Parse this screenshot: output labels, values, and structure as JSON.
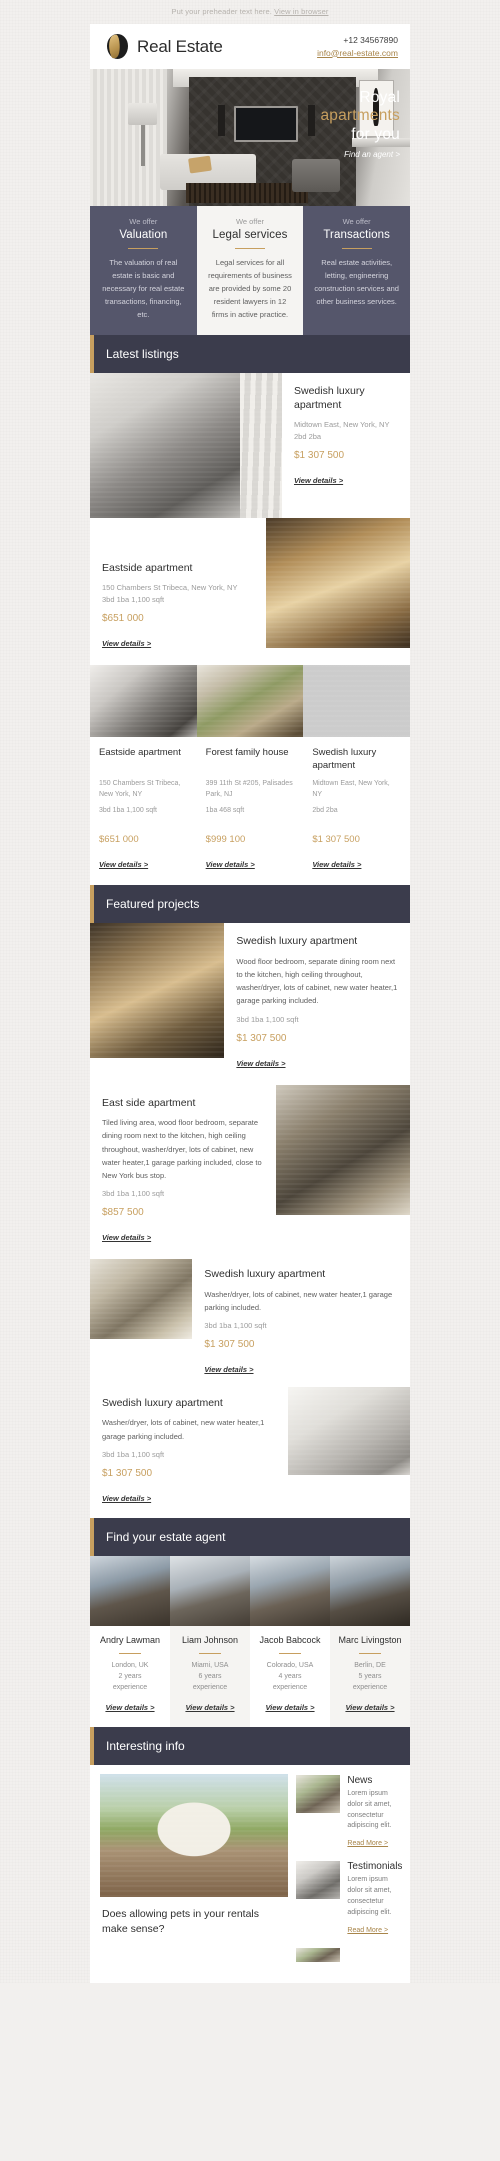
{
  "preheader": {
    "text": "Put your preheader text here.",
    "link": "View in browser"
  },
  "header": {
    "brand": "Real Estate",
    "phone": "+12 34567890",
    "email": "info@real-estate.com"
  },
  "hero": {
    "line1": "Royal",
    "line2": "apartments",
    "line3": "for you",
    "cta": "Find an agent >"
  },
  "offers": [
    {
      "kicker": "We offer",
      "title": "Valuation",
      "body": "The valuation of real estate is basic and necessary for real estate transactions, financing, etc."
    },
    {
      "kicker": "We offer",
      "title": "Legal services",
      "body": "Legal services for all requirements of business are provided by some 20 resident lawyers in 12 firms in active practice."
    },
    {
      "kicker": "We offer",
      "title": "Transactions",
      "body": "Real estate activities, letting, engineering construction services and other business services."
    }
  ],
  "sections": {
    "latest": "Latest listings",
    "featured": "Featured projects",
    "agents": "Find your estate agent",
    "info": "Interesting info"
  },
  "latest": {
    "card1": {
      "title": "Swedish luxury apartment",
      "meta": "Midtown East, New York, NY",
      "specs": "2bd 2ba",
      "price": "$1 307 500",
      "cta": "View details >"
    },
    "card2": {
      "title": "Eastside apartment",
      "meta": "150 Chambers St Tribeca, New York, NY",
      "specs": "3bd 1ba 1,100 sqft",
      "price": "$651 000",
      "cta": "View details >"
    },
    "tri": [
      {
        "title": "Eastside apartment",
        "meta": "150 Chambers St Tribeca, New York, NY",
        "specs": "3bd 1ba 1,100 sqft",
        "price": "$651 000",
        "cta": "View details >"
      },
      {
        "title": "Forest family house",
        "meta": "399 11th St #205, Palisades Park, NJ",
        "specs": "1ba 468 sqft",
        "price": "$999 100",
        "cta": "View details >"
      },
      {
        "title": "Swedish luxury apartment",
        "meta": "Midtown East, New York, NY",
        "specs": "2bd 2ba",
        "price": "$1 307 500",
        "cta": "View details >"
      }
    ]
  },
  "featured": {
    "card1": {
      "title": "Swedish luxury apartment",
      "desc": "Wood floor bedroom, separate dining room next to the kitchen, high ceiling throughout, washer/dryer, lots of cabinet, new water heater,1 garage parking included.",
      "specs": "3bd 1ba 1,100 sqft",
      "price": "$1 307 500",
      "cta": "View details >"
    },
    "card2": {
      "title": "East side apartment",
      "desc": "Tiled living area, wood floor bedroom, separate dining room next to the kitchen, high ceiling throughout, washer/dryer, lots of cabinet, new water heater,1 garage parking included, close to New York bus stop.",
      "specs": "3bd 1ba 1,100 sqft",
      "price": "$857 500",
      "cta": "View details >"
    },
    "card3": {
      "title": "Swedish luxury apartment",
      "desc": "Washer/dryer, lots of cabinet, new water heater,1 garage parking included.",
      "specs": "3bd 1ba 1,100 sqft",
      "price": "$1 307 500",
      "cta": "View details >"
    },
    "card4": {
      "title": "Swedish luxury apartment",
      "desc": "Washer/dryer, lots of cabinet, new water heater,1 garage parking included.",
      "specs": "3bd 1ba 1,100 sqft",
      "price": "$1 307 500",
      "cta": "View details >"
    }
  },
  "agents": [
    {
      "name": "Andry Lawman",
      "meta": "London, UK\n2 years\nexperience",
      "cta": "View details >"
    },
    {
      "name": "Liam Johnson",
      "meta": "Miami, USA\n6 years\nexperience",
      "cta": "View details >"
    },
    {
      "name": "Jacob Babcock",
      "meta": "Colorado, USA\n4 years\nexperience",
      "cta": "View details >"
    },
    {
      "name": "Marc Livingston",
      "meta": "Berlin, DE\n5 years\nexperience",
      "cta": "View details >"
    }
  ],
  "info": {
    "feature_title": "Does allowing pets in your rentals make sense?",
    "news": [
      {
        "heading": "News",
        "text": "Lorem ipsum dolor sit amet, consectetur adipiscing elit.",
        "cta": "Read More >"
      },
      {
        "heading": "Testimonials",
        "text": "Lorem ipsum dolor sit amet, consectetur adipiscing elit.",
        "cta": "Read More >"
      }
    ]
  },
  "colors": {
    "accent": "#c79f5f",
    "dark": "#3b3c4c",
    "slate": "#55566b"
  }
}
